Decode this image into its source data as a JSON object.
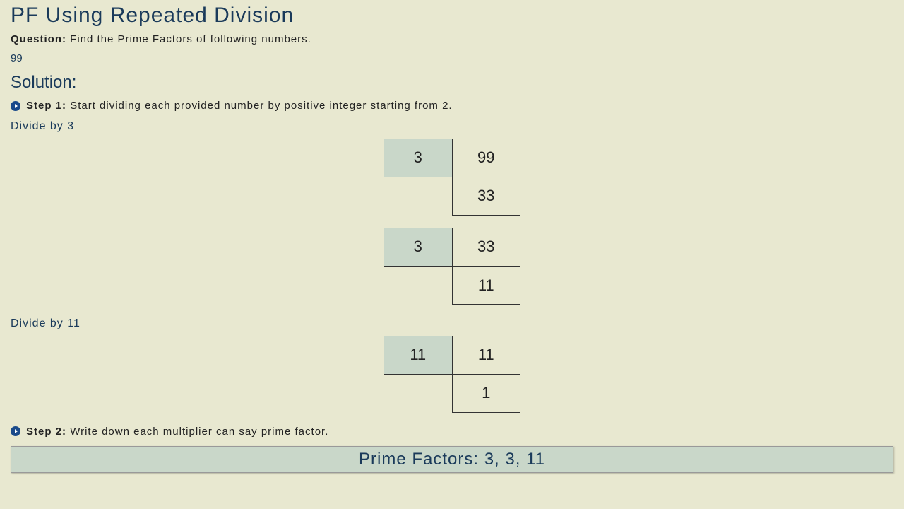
{
  "title": "PF Using Repeated Division",
  "question_label": "Question:",
  "question_text": "Find  the  Prime  Factors   of following  numbers.",
  "target_number": "99",
  "solution_heading": "Solution:",
  "step1_label": "Step 1:",
  "step1_text": "Start  dividing   each   provided   number  by  positive   integer  starting   from  2.",
  "divide_by_3": "Divide  by  3",
  "divide_by_11": "Divide  by  11",
  "div_ops": [
    {
      "divisor": "3",
      "dividend": "99",
      "quotient": "33"
    },
    {
      "divisor": "3",
      "dividend": "33",
      "quotient": "11"
    },
    {
      "divisor": "11",
      "dividend": "11",
      "quotient": "1"
    }
  ],
  "step2_label": "Step 2:",
  "step2_text": "Write  down  each  multiplier  can  say  prime  factor.",
  "answer": "Prime Factors: 3, 3, 11"
}
